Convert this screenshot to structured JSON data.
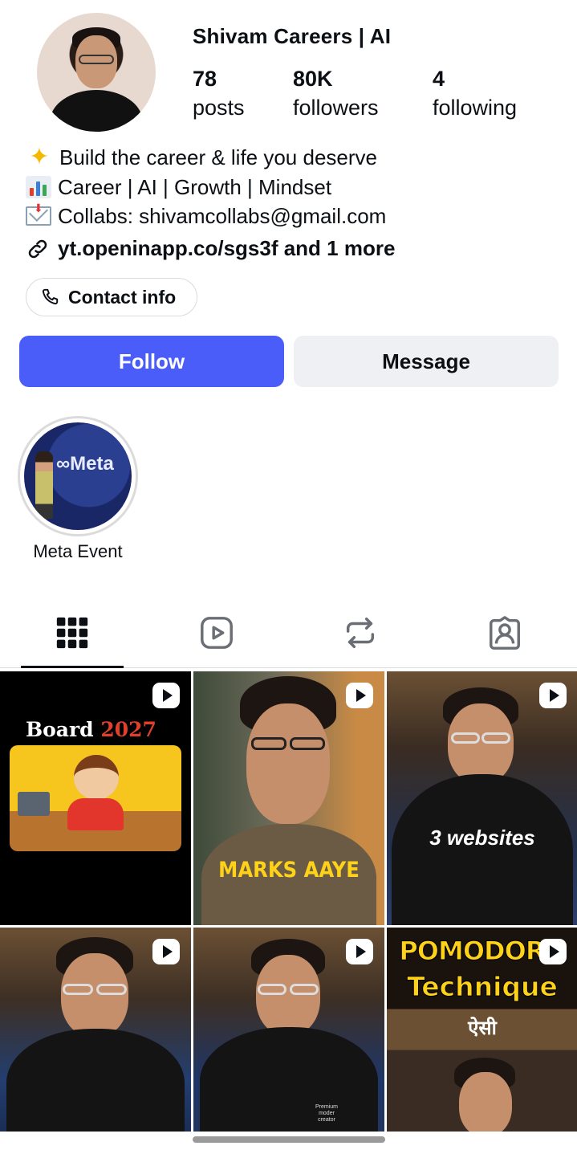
{
  "profile": {
    "name": "Shivam Careers | AI",
    "stats": [
      {
        "value": "78",
        "label": "posts"
      },
      {
        "value": "80K",
        "label": "followers"
      },
      {
        "value": "4",
        "label": "following"
      }
    ],
    "bio": [
      {
        "icon": "sparkle-star-icon",
        "text": "Build the career & life you deserve"
      },
      {
        "icon": "bar-chart-icon",
        "text": "Career | AI | Growth | Mindset"
      },
      {
        "icon": "incoming-envelope-icon",
        "text": "Collabs: shivamcollabs@gmail.com"
      }
    ],
    "link": "yt.openinapp.co/sgs3f and 1 more",
    "contact_label": "Contact info"
  },
  "actions": {
    "follow_label": "Follow",
    "message_label": "Message"
  },
  "highlights": [
    {
      "label": "Meta Event",
      "cover_text": "∞Meta"
    }
  ],
  "tabs": [
    {
      "name": "posts-grid",
      "icon": "grid-icon",
      "active": true
    },
    {
      "name": "reels",
      "icon": "reels-icon",
      "active": false
    },
    {
      "name": "reposts",
      "icon": "repost-icon",
      "active": false
    },
    {
      "name": "tagged",
      "icon": "tagged-person-icon",
      "active": false
    }
  ],
  "posts": [
    {
      "type": "reel",
      "caption_part1": "Board ",
      "caption_part2": "2027"
    },
    {
      "type": "reel",
      "caption": "MARKS AAYE"
    },
    {
      "type": "reel",
      "caption": "3 websites"
    },
    {
      "type": "reel",
      "caption": ""
    },
    {
      "type": "reel",
      "caption": "",
      "shirt_text": "Premium moder creator"
    },
    {
      "type": "reel",
      "caption_line1": "POMODORO",
      "caption_line2": "Technique",
      "caption_line3": "ऐसी"
    }
  ],
  "colors": {
    "accent": "#4a5df9",
    "secondary_button": "#eff0f4",
    "text": "#0c1014",
    "border": "#dbdbdb"
  }
}
